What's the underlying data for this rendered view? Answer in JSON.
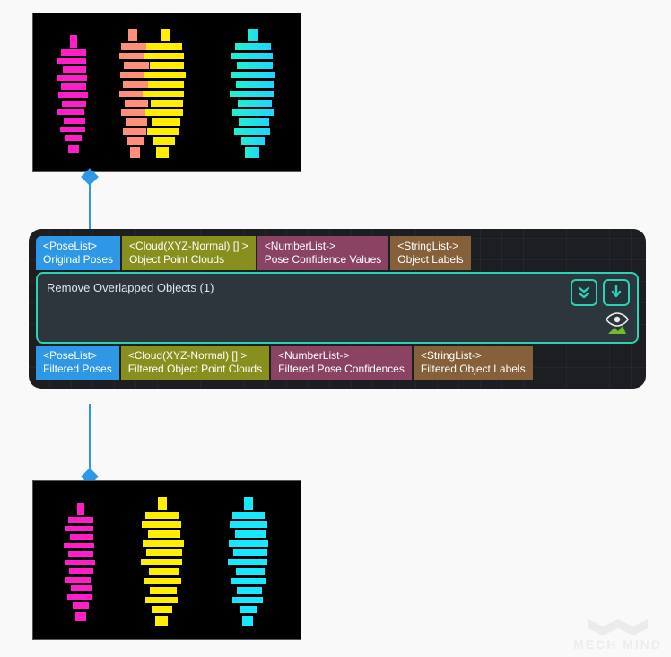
{
  "watermark": {
    "text": "MECH MIND"
  },
  "node": {
    "title": "Remove Overlapped Objects (1)",
    "inputs": [
      {
        "type": "<PoseList>",
        "label": "Original Poses",
        "color": "blue"
      },
      {
        "type": "<Cloud(XYZ-Normal) [] >",
        "label": "Object Point Clouds",
        "color": "olive"
      },
      {
        "type": "<NumberList->",
        "label": "Pose Confidence Values",
        "color": "plum"
      },
      {
        "type": "<StringList->",
        "label": "Object Labels",
        "color": "brown"
      }
    ],
    "outputs": [
      {
        "type": "<PoseList>",
        "label": "Filtered Poses",
        "color": "blue"
      },
      {
        "type": "<Cloud(XYZ-Normal) [] >",
        "label": "Filtered Object Point Clouds",
        "color": "olive"
      },
      {
        "type": "<NumberList->",
        "label": "Filtered Pose Confidences",
        "color": "plum"
      },
      {
        "type": "<StringList->",
        "label": "Filtered Object Labels",
        "color": "brown"
      }
    ]
  },
  "thumbnails": {
    "top": {
      "cluster_count": 4,
      "colors": [
        "magenta",
        "salmon",
        "yellow",
        "cyan"
      ]
    },
    "bottom": {
      "cluster_count": 3,
      "colors": [
        "magenta",
        "yellow",
        "cyan"
      ]
    }
  }
}
